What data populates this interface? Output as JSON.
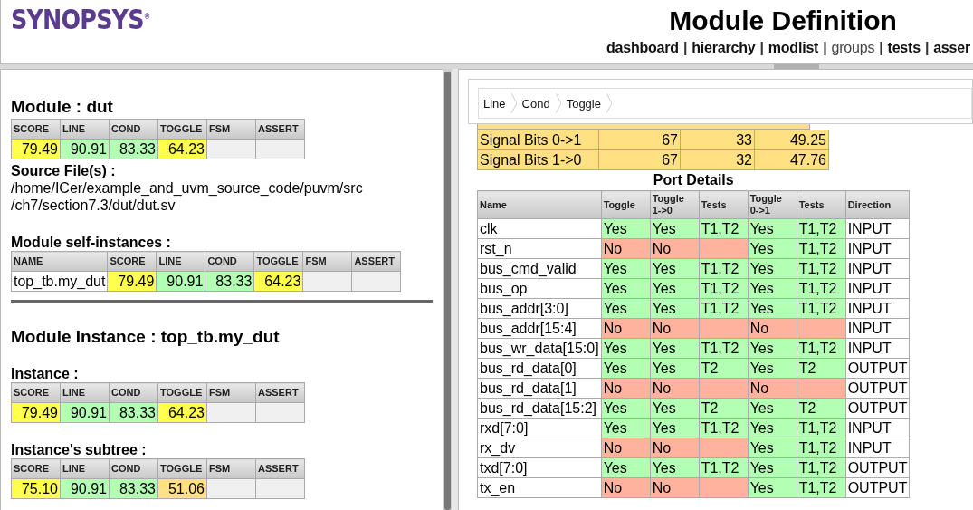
{
  "header": {
    "logo": "SYNOPSYS",
    "logo_mark": "®",
    "title": "Module Definition",
    "nav": [
      {
        "text": "dashboard",
        "kind": "link"
      },
      {
        "text": "|",
        "kind": "separator"
      },
      {
        "text": "hierarchy",
        "kind": "link"
      },
      {
        "text": "|",
        "kind": "separator"
      },
      {
        "text": "modlist",
        "kind": "link"
      },
      {
        "text": "|",
        "kind": "separator"
      },
      {
        "text": "groups",
        "kind": "plain"
      },
      {
        "text": "|",
        "kind": "separator"
      },
      {
        "text": "tests",
        "kind": "link"
      },
      {
        "text": "|",
        "kind": "separator"
      },
      {
        "text": "asser",
        "kind": "link"
      }
    ]
  },
  "left": {
    "module_title": "Module : dut",
    "module_scores": {
      "columns": [
        "SCORE",
        "LINE",
        "COND",
        "TOGGLE",
        "FSM",
        "ASSERT"
      ],
      "rows": [
        [
          {
            "text": "79.49",
            "color": "#ffff4d"
          },
          {
            "text": "90.91",
            "color": "#b3ffb3"
          },
          {
            "text": "83.33",
            "color": "#b3ffb3"
          },
          {
            "text": "64.23",
            "color": "#ffff4d"
          },
          {
            "text": "",
            "color": "#f0f0f0"
          },
          {
            "text": "",
            "color": "#f0f0f0"
          }
        ]
      ]
    },
    "source_label": "Source File(s) :",
    "source_lines": [
      "/home/ICer/example_and_uvm_source_code/puvm/src",
      "/ch7/section7.3/dut/dut.sv"
    ],
    "self_instances_label": "Module self-instances :",
    "self_instances": {
      "columns": [
        "NAME",
        "SCORE",
        "LINE",
        "COND",
        "TOGGLE",
        "FSM",
        "ASSERT"
      ],
      "rows": [
        [
          {
            "text": "top_tb.my_dut",
            "color": "#ffffff"
          },
          {
            "text": "79.49",
            "color": "#ffff4d"
          },
          {
            "text": "90.91",
            "color": "#b3ffb3"
          },
          {
            "text": "83.33",
            "color": "#b3ffb3"
          },
          {
            "text": "64.23",
            "color": "#ffff4d"
          },
          {
            "text": "",
            "color": "#f0f0f0"
          },
          {
            "text": "",
            "color": "#f0f0f0"
          }
        ]
      ]
    },
    "instance_title": "Module Instance : top_tb.my_dut",
    "instance_label": "Instance :",
    "instance_scores": {
      "columns": [
        "SCORE",
        "LINE",
        "COND",
        "TOGGLE",
        "FSM",
        "ASSERT"
      ],
      "rows": [
        [
          {
            "text": "79.49",
            "color": "#ffff4d"
          },
          {
            "text": "90.91",
            "color": "#b3ffb3"
          },
          {
            "text": "83.33",
            "color": "#b3ffb3"
          },
          {
            "text": "64.23",
            "color": "#ffff4d"
          },
          {
            "text": "",
            "color": "#f0f0f0"
          },
          {
            "text": "",
            "color": "#f0f0f0"
          }
        ]
      ]
    },
    "subtree_label": "Instance's subtree :",
    "subtree_scores": {
      "columns": [
        "SCORE",
        "LINE",
        "COND",
        "TOGGLE",
        "FSM",
        "ASSERT"
      ],
      "rows": [
        [
          {
            "text": "75.10",
            "color": "#ffff4d"
          },
          {
            "text": "90.91",
            "color": "#b3ffb3"
          },
          {
            "text": "83.33",
            "color": "#b3ffb3"
          },
          {
            "text": "51.06",
            "color": "#ffe082"
          },
          {
            "text": "",
            "color": "#f0f0f0"
          },
          {
            "text": "",
            "color": "#f0f0f0"
          }
        ]
      ]
    }
  },
  "right": {
    "breadcrumb": [
      "Line",
      "Cond",
      "Toggle"
    ],
    "signal_bits": [
      [
        "Signal Bits 0->1",
        "67",
        "33",
        "49.25"
      ],
      [
        "Signal Bits 1->0",
        "67",
        "32",
        "47.76"
      ]
    ],
    "port_title": "Port Details",
    "port_columns": [
      [
        "Name"
      ],
      [
        "Toggle"
      ],
      [
        "Toggle",
        "1->0"
      ],
      [
        "Tests"
      ],
      [
        "Toggle",
        "0->1"
      ],
      [
        "Tests"
      ],
      [
        "Direction"
      ]
    ],
    "ports": [
      {
        "name": "clk",
        "cells": [
          {
            "text": "Yes",
            "color": "#b3ffb3"
          },
          {
            "text": "Yes",
            "color": "#b3ffb3"
          },
          {
            "text": "T1,T2",
            "color": "#b3ffb3"
          },
          {
            "text": "Yes",
            "color": "#b3ffb3"
          },
          {
            "text": "T1,T2",
            "color": "#b3ffb3"
          }
        ],
        "direction": "INPUT"
      },
      {
        "name": "rst_n",
        "cells": [
          {
            "text": "No",
            "color": "#ffb39f"
          },
          {
            "text": "No",
            "color": "#ffb39f"
          },
          {
            "text": "",
            "color": "#ffb39f"
          },
          {
            "text": "Yes",
            "color": "#b3ffb3"
          },
          {
            "text": "T1,T2",
            "color": "#b3ffb3"
          }
        ],
        "direction": "INPUT"
      },
      {
        "name": "bus_cmd_valid",
        "cells": [
          {
            "text": "Yes",
            "color": "#b3ffb3"
          },
          {
            "text": "Yes",
            "color": "#b3ffb3"
          },
          {
            "text": "T1,T2",
            "color": "#b3ffb3"
          },
          {
            "text": "Yes",
            "color": "#b3ffb3"
          },
          {
            "text": "T1,T2",
            "color": "#b3ffb3"
          }
        ],
        "direction": "INPUT"
      },
      {
        "name": "bus_op",
        "cells": [
          {
            "text": "Yes",
            "color": "#b3ffb3"
          },
          {
            "text": "Yes",
            "color": "#b3ffb3"
          },
          {
            "text": "T1,T2",
            "color": "#b3ffb3"
          },
          {
            "text": "Yes",
            "color": "#b3ffb3"
          },
          {
            "text": "T1,T2",
            "color": "#b3ffb3"
          }
        ],
        "direction": "INPUT"
      },
      {
        "name": "bus_addr[3:0]",
        "cells": [
          {
            "text": "Yes",
            "color": "#b3ffb3"
          },
          {
            "text": "Yes",
            "color": "#b3ffb3"
          },
          {
            "text": "T1,T2",
            "color": "#b3ffb3"
          },
          {
            "text": "Yes",
            "color": "#b3ffb3"
          },
          {
            "text": "T1,T2",
            "color": "#b3ffb3"
          }
        ],
        "direction": "INPUT"
      },
      {
        "name": "bus_addr[15:4]",
        "cells": [
          {
            "text": "No",
            "color": "#ffb39f"
          },
          {
            "text": "No",
            "color": "#ffb39f"
          },
          {
            "text": "",
            "color": "#ffb39f"
          },
          {
            "text": "No",
            "color": "#ffb39f"
          },
          {
            "text": "",
            "color": "#ffb39f"
          }
        ],
        "direction": "INPUT"
      },
      {
        "name": "bus_wr_data[15:0]",
        "cells": [
          {
            "text": "Yes",
            "color": "#b3ffb3"
          },
          {
            "text": "Yes",
            "color": "#b3ffb3"
          },
          {
            "text": "T1,T2",
            "color": "#b3ffb3"
          },
          {
            "text": "Yes",
            "color": "#b3ffb3"
          },
          {
            "text": "T1,T2",
            "color": "#b3ffb3"
          }
        ],
        "direction": "INPUT"
      },
      {
        "name": "bus_rd_data[0]",
        "cells": [
          {
            "text": "Yes",
            "color": "#b3ffb3"
          },
          {
            "text": "Yes",
            "color": "#b3ffb3"
          },
          {
            "text": "T2",
            "color": "#b3ffb3"
          },
          {
            "text": "Yes",
            "color": "#b3ffb3"
          },
          {
            "text": "T2",
            "color": "#b3ffb3"
          }
        ],
        "direction": "OUTPUT"
      },
      {
        "name": "bus_rd_data[1]",
        "cells": [
          {
            "text": "No",
            "color": "#ffb39f"
          },
          {
            "text": "No",
            "color": "#ffb39f"
          },
          {
            "text": "",
            "color": "#ffb39f"
          },
          {
            "text": "No",
            "color": "#ffb39f"
          },
          {
            "text": "",
            "color": "#ffb39f"
          }
        ],
        "direction": "OUTPUT"
      },
      {
        "name": "bus_rd_data[15:2]",
        "cells": [
          {
            "text": "Yes",
            "color": "#b3ffb3"
          },
          {
            "text": "Yes",
            "color": "#b3ffb3"
          },
          {
            "text": "T2",
            "color": "#b3ffb3"
          },
          {
            "text": "Yes",
            "color": "#b3ffb3"
          },
          {
            "text": "T2",
            "color": "#b3ffb3"
          }
        ],
        "direction": "OUTPUT"
      },
      {
        "name": "rxd[7:0]",
        "cells": [
          {
            "text": "Yes",
            "color": "#b3ffb3"
          },
          {
            "text": "Yes",
            "color": "#b3ffb3"
          },
          {
            "text": "T1,T2",
            "color": "#b3ffb3"
          },
          {
            "text": "Yes",
            "color": "#b3ffb3"
          },
          {
            "text": "T1,T2",
            "color": "#b3ffb3"
          }
        ],
        "direction": "INPUT"
      },
      {
        "name": "rx_dv",
        "cells": [
          {
            "text": "No",
            "color": "#ffb39f"
          },
          {
            "text": "No",
            "color": "#ffb39f"
          },
          {
            "text": "",
            "color": "#ffb39f"
          },
          {
            "text": "Yes",
            "color": "#b3ffb3"
          },
          {
            "text": "T1,T2",
            "color": "#b3ffb3"
          }
        ],
        "direction": "INPUT"
      },
      {
        "name": "txd[7:0]",
        "cells": [
          {
            "text": "Yes",
            "color": "#b3ffb3"
          },
          {
            "text": "Yes",
            "color": "#b3ffb3"
          },
          {
            "text": "T1,T2",
            "color": "#b3ffb3"
          },
          {
            "text": "Yes",
            "color": "#b3ffb3"
          },
          {
            "text": "T1,T2",
            "color": "#b3ffb3"
          }
        ],
        "direction": "OUTPUT"
      },
      {
        "name": "tx_en",
        "cells": [
          {
            "text": "No",
            "color": "#ffb39f"
          },
          {
            "text": "No",
            "color": "#ffb39f"
          },
          {
            "text": "",
            "color": "#ffb39f"
          },
          {
            "text": "Yes",
            "color": "#b3ffb3"
          },
          {
            "text": "T1,T2",
            "color": "#b3ffb3"
          }
        ],
        "direction": "OUTPUT"
      }
    ]
  }
}
